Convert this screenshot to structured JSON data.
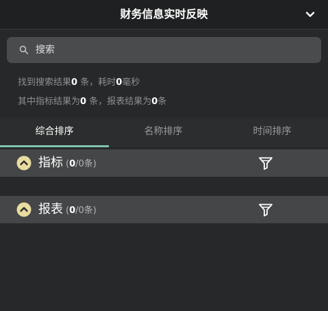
{
  "header": {
    "title": "财务信息实时反映",
    "collapse_icon": "chevron-down-icon"
  },
  "search": {
    "placeholder": "搜索",
    "value": "",
    "icon": "search-icon"
  },
  "summary": {
    "line1_prefix": "找到搜索结果",
    "line1_count": "0",
    "line1_mid": " 条，耗时",
    "line1_time": "0",
    "line1_suffix": "毫秒",
    "line2_prefix": "其中指标结果为",
    "line2_indicator_count": "0",
    "line2_mid": " 条，报表结果为",
    "line2_report_count": "0",
    "line2_suffix": "条"
  },
  "tabs": [
    {
      "label": "综合排序",
      "active": true
    },
    {
      "label": "名称排序",
      "active": false
    },
    {
      "label": "时间排序",
      "active": false
    }
  ],
  "sections": [
    {
      "title": "指标",
      "count_open": "(",
      "count_current": "0",
      "count_rest": "/0条)",
      "toggle_icon": "chevron-up-circle-icon",
      "filter_icon": "filter-icon"
    },
    {
      "title": "报表",
      "count_open": "(",
      "count_current": "0",
      "count_rest": "/0条)",
      "toggle_icon": "chevron-up-circle-icon",
      "filter_icon": "filter-icon"
    }
  ],
  "colors": {
    "accent": "#7fc6ae",
    "background": "#272829",
    "section_bar": "#454647",
    "toggle_fill": "#e8dca0"
  }
}
